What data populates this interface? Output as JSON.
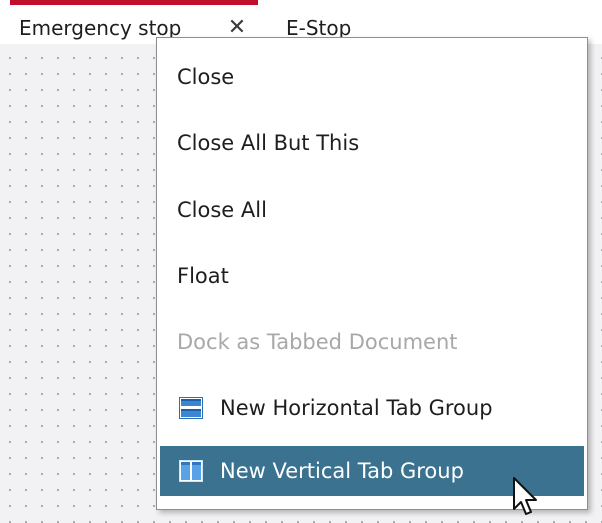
{
  "tabs": [
    {
      "label": "Emergency stop",
      "active": true,
      "close_glyph": "✕"
    },
    {
      "label": "E-Stop",
      "active": false
    }
  ],
  "context_menu": {
    "items": [
      {
        "label": "Close",
        "enabled": true
      },
      {
        "label": "Close All But This",
        "enabled": true
      },
      {
        "label": "Close All",
        "enabled": true
      },
      {
        "label": "Float",
        "enabled": true
      },
      {
        "label": "Dock as Tabbed Document",
        "enabled": false
      },
      {
        "label": "New Horizontal Tab Group",
        "enabled": true,
        "icon": "horizontal-tab-group-icon"
      },
      {
        "label": "New Vertical Tab Group",
        "enabled": true,
        "icon": "vertical-tab-group-icon",
        "highlighted": true
      }
    ]
  },
  "colors": {
    "active_tab_accent": "#c0102d",
    "menu_highlight": "#3a7290",
    "disabled_text": "#a8a8a8"
  }
}
